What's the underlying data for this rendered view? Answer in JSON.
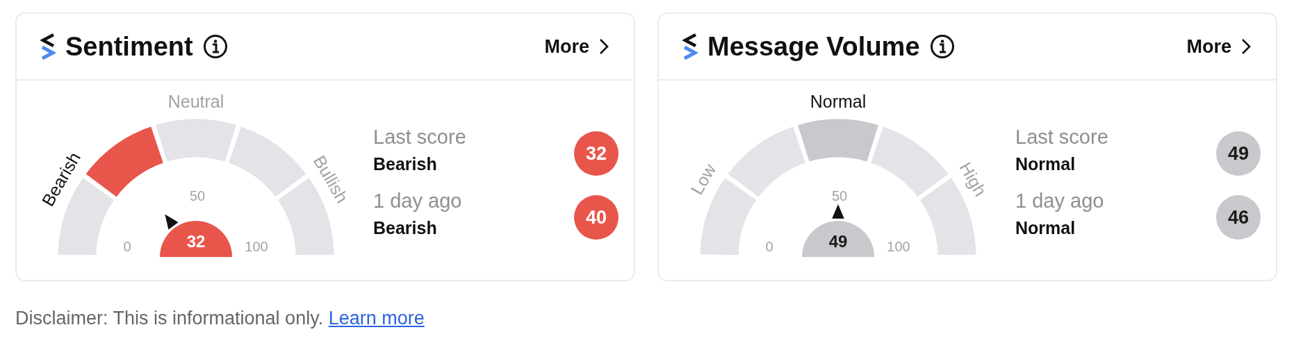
{
  "cards": [
    {
      "title": "Sentiment",
      "more": "More",
      "kind": "alert",
      "gauge": {
        "segments": [
          {
            "selected": false
          },
          {
            "selected": true
          },
          {
            "selected": false
          },
          {
            "selected": false
          },
          {
            "selected": false
          }
        ],
        "labels": [
          {
            "text": "Bearish",
            "selected": true
          },
          {
            "text": "Neutral",
            "selected": false
          },
          {
            "text": "Bullish",
            "selected": false
          }
        ],
        "ticks": [
          "0",
          "50",
          "100"
        ],
        "value": "32"
      },
      "scores": [
        {
          "label": "Last score",
          "value": "Bearish",
          "badge": "32"
        },
        {
          "label": "1 day ago",
          "value": "Bearish",
          "badge": "40"
        }
      ]
    },
    {
      "title": "Message Volume",
      "more": "More",
      "kind": "neutral",
      "gauge": {
        "segments": [
          {
            "selected": false
          },
          {
            "selected": false
          },
          {
            "selected": true
          },
          {
            "selected": false
          },
          {
            "selected": false
          }
        ],
        "labels": [
          {
            "text": "Low",
            "selected": false
          },
          {
            "text": "Normal",
            "selected": true
          },
          {
            "text": "High",
            "selected": false
          }
        ],
        "ticks": [
          "0",
          "50",
          "100"
        ],
        "value": "49"
      },
      "scores": [
        {
          "label": "Last score",
          "value": "Normal",
          "badge": "49"
        },
        {
          "label": "1 day ago",
          "value": "Normal",
          "badge": "46"
        }
      ]
    }
  ],
  "disclaimer": {
    "text": "Disclaimer: This is informational only.",
    "link": "Learn more"
  }
}
